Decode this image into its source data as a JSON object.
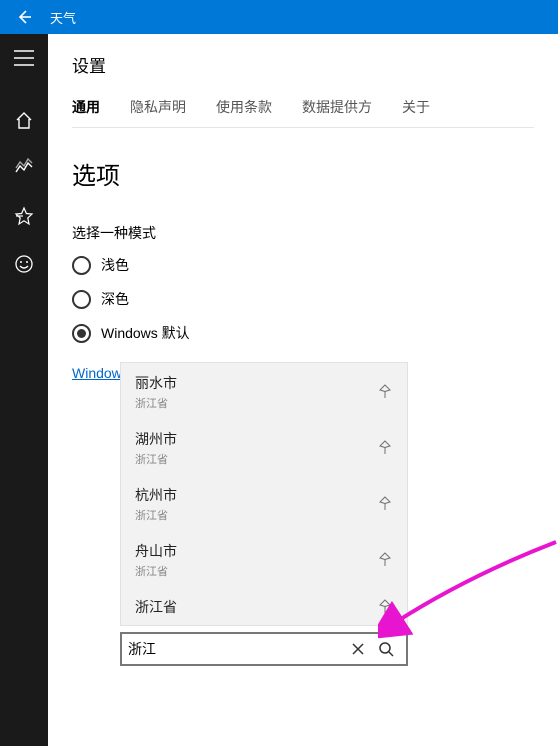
{
  "titlebar": {
    "title": "天气"
  },
  "sidebar": {
    "items": [
      "menu",
      "home",
      "chart",
      "star",
      "smile"
    ]
  },
  "header": {
    "page_title": "设置",
    "tabs": [
      {
        "label": "通用",
        "active": true
      },
      {
        "label": "隐私声明",
        "active": false
      },
      {
        "label": "使用条款",
        "active": false
      },
      {
        "label": "数据提供方",
        "active": false
      },
      {
        "label": "关于",
        "active": false
      }
    ]
  },
  "options": {
    "section_title": "选项",
    "mode_label": "选择一种模式",
    "modes": [
      {
        "label": "浅色",
        "checked": false
      },
      {
        "label": "深色",
        "checked": false
      },
      {
        "label": "Windows 默认",
        "checked": true
      }
    ],
    "color_link": "Windows 颜色设置"
  },
  "search": {
    "value": "浙江",
    "suggestions": [
      {
        "city": "丽水市",
        "province": "浙江省"
      },
      {
        "city": "湖州市",
        "province": "浙江省"
      },
      {
        "city": "杭州市",
        "province": "浙江省"
      },
      {
        "city": "舟山市",
        "province": "浙江省"
      },
      {
        "city": "浙江省",
        "province": ""
      }
    ]
  }
}
